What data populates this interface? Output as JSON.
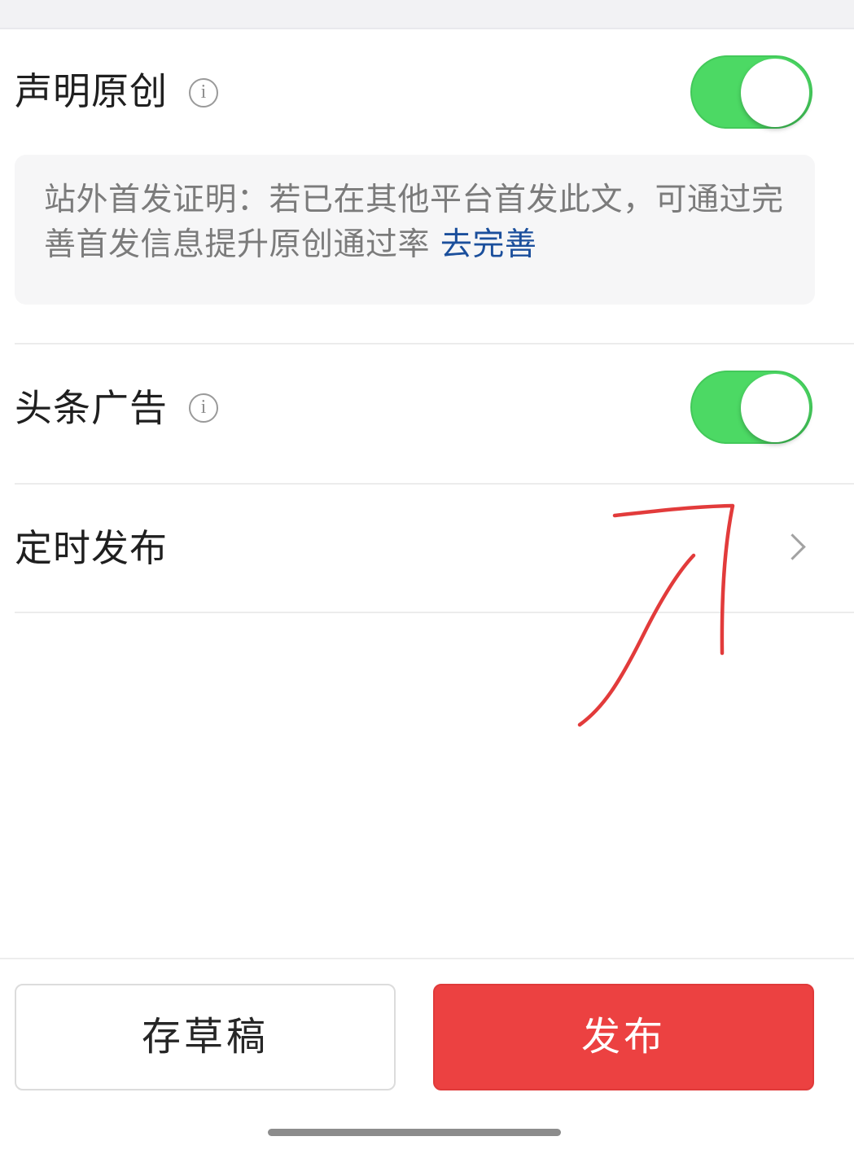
{
  "settings": {
    "original": {
      "label": "声明原创",
      "info_icon": "i",
      "enabled": true
    },
    "notice": {
      "text": "站外首发证明：若已在其他平台首发此文，可通过完善首发信息提升原创通过率 ",
      "link_label": "去完善"
    },
    "ads": {
      "label": "头条广告",
      "info_icon": "i",
      "enabled": true
    },
    "schedule": {
      "label": "定时发布"
    }
  },
  "actions": {
    "save_draft_label": "存草稿",
    "publish_label": "发布"
  },
  "colors": {
    "toggle_on": "#4cd964",
    "publish_button": "#ec4141",
    "link": "#1b4f9c",
    "annotation_arrow": "#e23b3b"
  },
  "icons": {
    "info": "info-circle-icon",
    "chevron": "chevron-right-icon",
    "annotation": "hand-drawn-arrow-icon"
  }
}
